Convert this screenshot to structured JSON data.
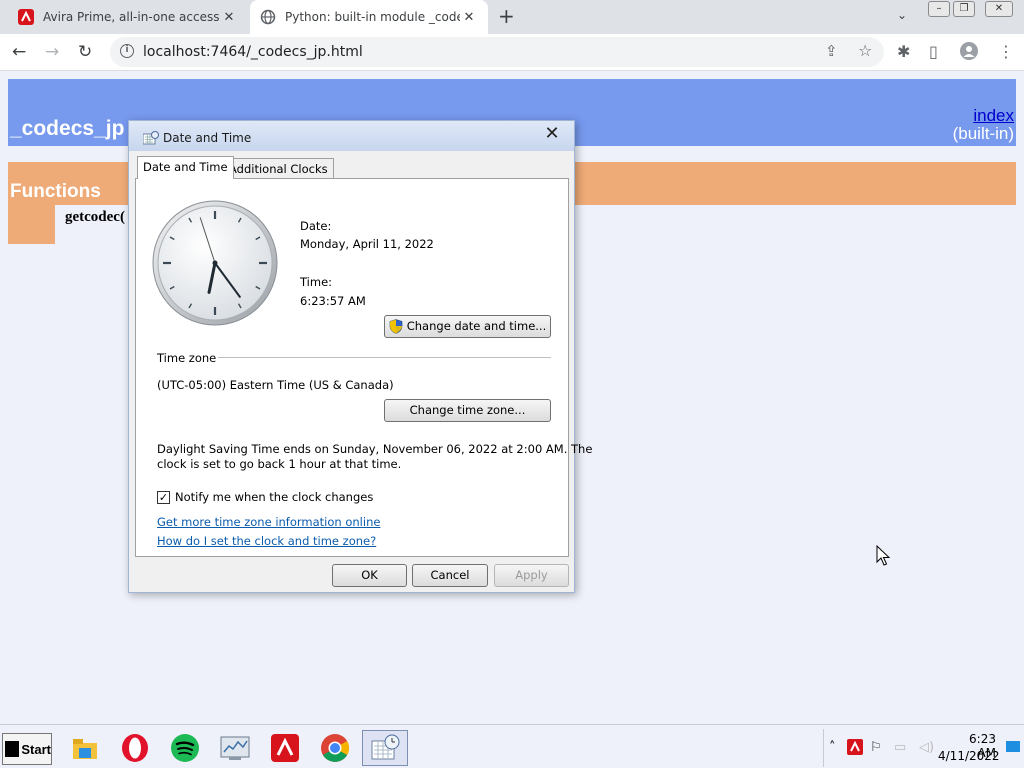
{
  "browser": {
    "tabs": [
      {
        "title": "Avira Prime, all-in-one access to",
        "icon": "avira-icon",
        "active": false
      },
      {
        "title": "Python: built-in module _codecs_",
        "icon": "globe-icon",
        "active": true
      }
    ],
    "url": "localhost:7464/_codecs_jp.html"
  },
  "page": {
    "module_title": "_codecs_jp",
    "index_link": "index",
    "builtin": "(built-in)",
    "functions_heading": "Functions",
    "function_entry": "getcodec("
  },
  "dialog": {
    "title": "Date and Time",
    "tabs": [
      "Date and Time",
      "Additional Clocks"
    ],
    "date_label": "Date:",
    "date_value": "Monday, April 11, 2022",
    "time_label": "Time:",
    "time_value": "6:23:57 AM",
    "clock": {
      "hour": 6,
      "minute": 23,
      "second": 57
    },
    "change_dt_button": "Change date and time...",
    "timezone_heading": "Time zone",
    "timezone_value": "(UTC-05:00) Eastern Time (US & Canada)",
    "change_tz_button": "Change time zone...",
    "dst_line1": "Daylight Saving Time ends on Sunday, November 06, 2022 at 2:00 AM. The",
    "dst_line2": "clock is set to go back 1 hour at that time.",
    "notify_label": "Notify me when the clock changes",
    "notify_checked": true,
    "link_more_info": "Get more time zone information online",
    "link_how_to": "How do I set the clock and time zone?",
    "ok": "OK",
    "cancel": "Cancel",
    "apply": "Apply"
  },
  "taskbar": {
    "start": "Start",
    "apps": [
      "file-explorer-icon",
      "opera-icon",
      "spotify-icon",
      "system-monitor-icon",
      "avira-icon",
      "chrome-icon",
      "date-time-icon"
    ],
    "time": "6:23 AM",
    "date": "4/11/2022"
  }
}
